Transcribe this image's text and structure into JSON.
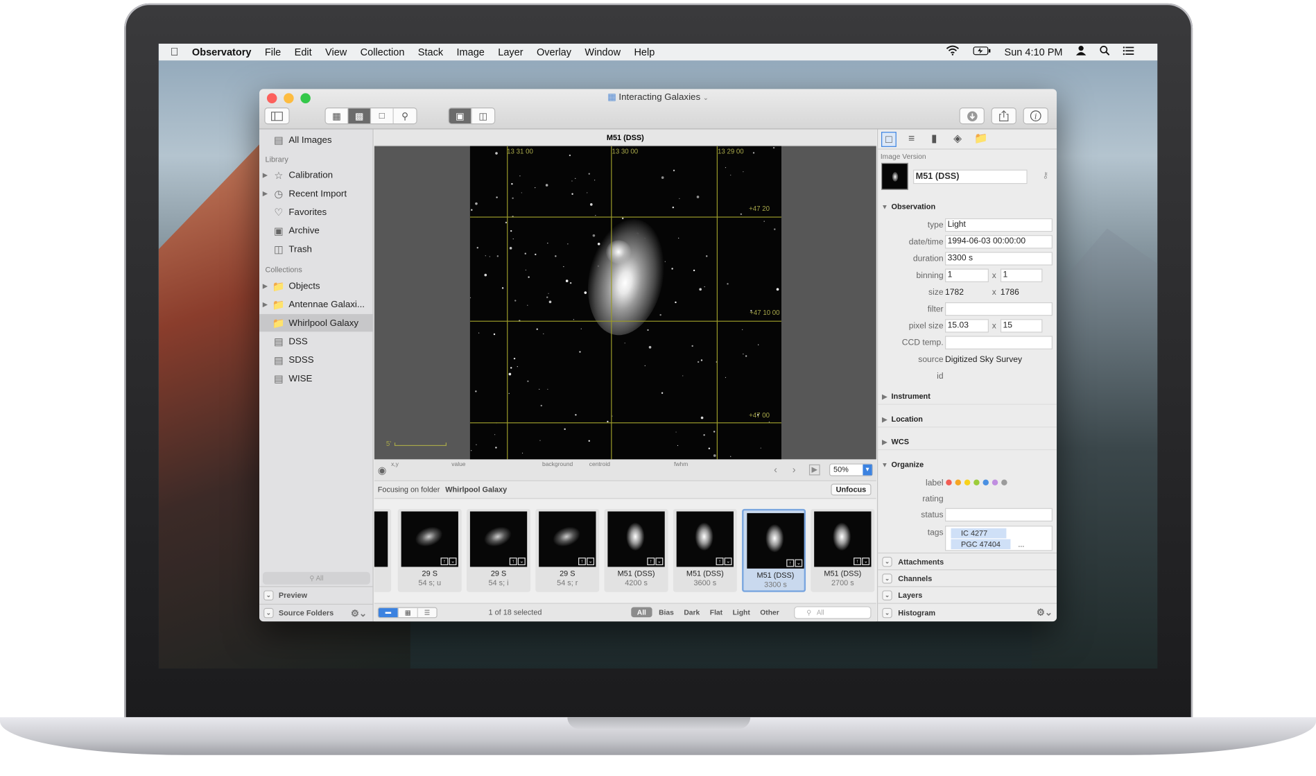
{
  "menubar": {
    "apple": "",
    "app": "Observatory",
    "menus": [
      "File",
      "Edit",
      "View",
      "Collection",
      "Stack",
      "Image",
      "Layer",
      "Overlay",
      "Window",
      "Help"
    ],
    "clock": "Sun 4:10 PM"
  },
  "window": {
    "title": "Interacting Galaxies",
    "light_colors": [
      "#fc605c",
      "#fdbc40",
      "#34c84a"
    ]
  },
  "sidebar": {
    "all_images": "All Images",
    "library_header": "Library",
    "library": [
      {
        "label": "Calibration",
        "icon": "star-icon",
        "disclosure": true
      },
      {
        "label": "Recent Import",
        "icon": "clock-icon",
        "disclosure": true
      },
      {
        "label": "Favorites",
        "icon": "heart-icon",
        "disclosure": false
      },
      {
        "label": "Archive",
        "icon": "archive-icon",
        "disclosure": false
      },
      {
        "label": "Trash",
        "icon": "trash-icon",
        "disclosure": false
      }
    ],
    "collections_header": "Collections",
    "collections": [
      {
        "label": "Objects",
        "icon": "folder-icon",
        "disclosure": true
      },
      {
        "label": "Antennae Galaxi...",
        "icon": "folder-icon",
        "disclosure": true
      },
      {
        "label": "Whirlpool Galaxy",
        "icon": "folder-icon",
        "disclosure": false,
        "selected": true
      },
      {
        "label": "DSS",
        "icon": "stack-icon",
        "child": true
      },
      {
        "label": "SDSS",
        "icon": "stack-icon",
        "child": true
      },
      {
        "label": "WISE",
        "icon": "stack-icon",
        "child": true
      }
    ],
    "search_placeholder": "All",
    "preview_label": "Preview",
    "source_folders_label": "Source Folders"
  },
  "viewer": {
    "image_title": "M51 (DSS)",
    "grid_ra": [
      "13 31 00",
      "13 30 00",
      "13 29 00"
    ],
    "grid_dec": [
      "+47 20",
      "+47 10 00",
      "+47 00"
    ],
    "scale_label": "5'",
    "info_labels": {
      "xy": "x,y",
      "value": "value",
      "background": "background",
      "centroid": "centroid",
      "fwhm": "fwhm"
    },
    "zoom": "50%"
  },
  "focus": {
    "prefix": "Focusing on folder",
    "folder": "Whirlpool Galaxy",
    "unfocus": "Unfocus"
  },
  "thumbnails": [
    {
      "title": "29 S",
      "sub": "54 s; u",
      "selected": false
    },
    {
      "title": "29 S",
      "sub": "54 s; i",
      "selected": false
    },
    {
      "title": "29 S",
      "sub": "54 s; r",
      "selected": false
    },
    {
      "title": "M51 (DSS)",
      "sub": "4200 s",
      "selected": false
    },
    {
      "title": "M51 (DSS)",
      "sub": "3600 s",
      "selected": false
    },
    {
      "title": "M51 (DSS)",
      "sub": "3300 s",
      "selected": true
    },
    {
      "title": "M51 (DSS)",
      "sub": "2700 s",
      "selected": false
    }
  ],
  "bottombar": {
    "selection": "1 of 18 selected",
    "filters": [
      "All",
      "Bias",
      "Dark",
      "Flat",
      "Light",
      "Other"
    ],
    "search_placeholder": "All"
  },
  "inspector": {
    "section_label": "Image Version",
    "name": "M51 (DSS)",
    "observation_header": "Observation",
    "type_label": "type",
    "type": "Light",
    "datetime_label": "date/time",
    "datetime": "1994-06-03 00:00:00",
    "duration_label": "duration",
    "duration": "3300 s",
    "binning_label": "binning",
    "binning_x": "1",
    "binning_y": "1",
    "size_label": "size",
    "size_x": "1782",
    "size_y": "1786",
    "filter_label": "filter",
    "filter": "",
    "pixel_size_label": "pixel size",
    "pixel_x": "15.03",
    "pixel_y": "15",
    "ccd_label": "CCD temp.",
    "ccd": "",
    "source_label": "source",
    "source": "Digitized Sky Survey",
    "id_label": "id",
    "x_sep": "x",
    "instrument_header": "Instrument",
    "location_header": "Location",
    "wcs_header": "WCS",
    "organize_header": "Organize",
    "label_label": "label",
    "label_colors": [
      "#f25c54",
      "#f5a623",
      "#f8d21b",
      "#9ccc3a",
      "#4a90e2",
      "#c08ee0",
      "#9b9b9b"
    ],
    "rating_label": "rating",
    "status_label": "status",
    "tags_label": "tags",
    "tags": [
      "IC 4277",
      "PGC 47404"
    ],
    "tags_more": "...",
    "attachments": "Attachments",
    "channels": "Channels",
    "layers": "Layers",
    "histogram": "Histogram"
  }
}
